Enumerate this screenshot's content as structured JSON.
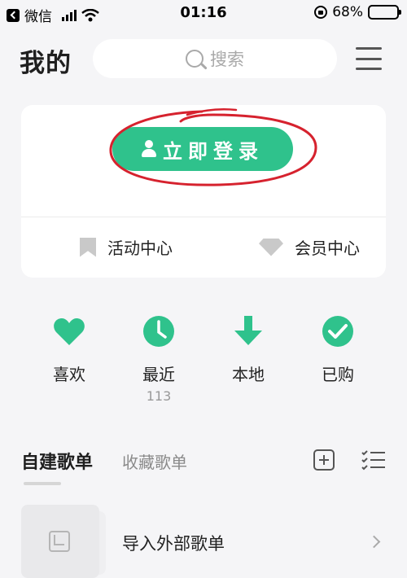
{
  "status_bar": {
    "carrier": "微信",
    "time": "01:16",
    "battery": "68%",
    "battery_level": 0.68
  },
  "header": {
    "title": "我的",
    "search_placeholder": "搜索"
  },
  "login_card": {
    "login_label": "立即登录",
    "links": [
      {
        "label": "活动中心",
        "icon": "bookmark-icon"
      },
      {
        "label": "会员中心",
        "icon": "diamond-icon"
      }
    ]
  },
  "quick_actions": [
    {
      "label": "喜欢",
      "icon": "heart-icon"
    },
    {
      "label": "最近",
      "icon": "clock-icon",
      "count": "113"
    },
    {
      "label": "本地",
      "icon": "download-icon"
    },
    {
      "label": "已购",
      "icon": "check-circle-icon"
    }
  ],
  "playlist_tabs": {
    "active": "自建歌单",
    "inactive": "收藏歌单"
  },
  "import_row": {
    "label": "导入外部歌单"
  },
  "colors": {
    "accent": "#2fc28c",
    "annotation": "#d6222e",
    "background": "#f5f5f7"
  }
}
